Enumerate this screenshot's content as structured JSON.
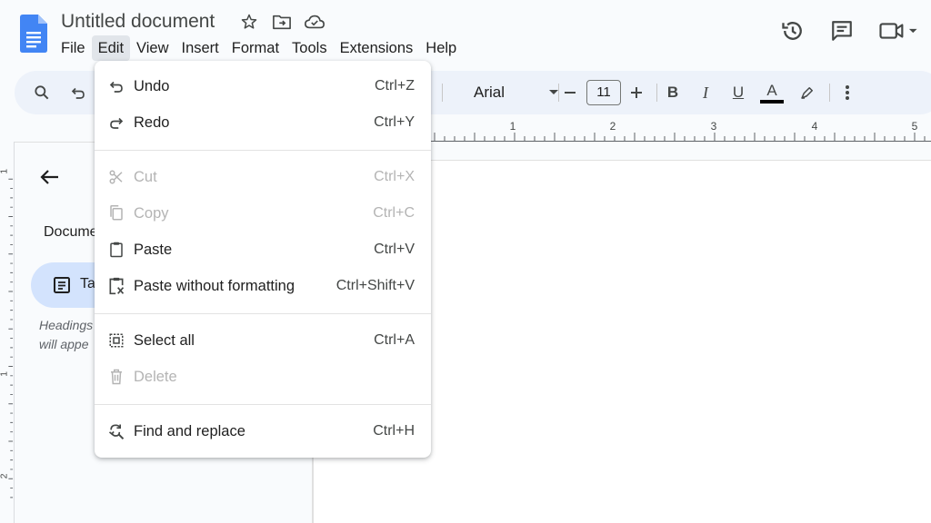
{
  "header": {
    "doc_title": "Untitled document",
    "menu": [
      "File",
      "Edit",
      "View",
      "Insert",
      "Format",
      "Tools",
      "Extensions",
      "Help"
    ],
    "active_menu": "Edit"
  },
  "toolbar": {
    "font_name": "Arial",
    "font_size": "11",
    "bold_label": "B",
    "italic_label": "I",
    "underline_label": "U",
    "text_color_label": "A"
  },
  "ruler": {
    "marks": [
      "1",
      "2",
      "3",
      "4",
      "5"
    ],
    "side_marks": [
      "1",
      "1",
      "2"
    ]
  },
  "sidebar": {
    "heading": "Docume",
    "tab_label": "Ta",
    "note_line1": "Headings",
    "note_line2": "will appe"
  },
  "edit_menu": {
    "groups": [
      [
        {
          "label": "Undo",
          "shortcut": "Ctrl+Z",
          "icon": "undo-icon",
          "disabled": false
        },
        {
          "label": "Redo",
          "shortcut": "Ctrl+Y",
          "icon": "redo-icon",
          "disabled": false
        }
      ],
      [
        {
          "label": "Cut",
          "shortcut": "Ctrl+X",
          "icon": "scissors-icon",
          "disabled": true
        },
        {
          "label": "Copy",
          "shortcut": "Ctrl+C",
          "icon": "copy-icon",
          "disabled": true
        },
        {
          "label": "Paste",
          "shortcut": "Ctrl+V",
          "icon": "clipboard-icon",
          "disabled": false
        },
        {
          "label": "Paste without formatting",
          "shortcut": "Ctrl+Shift+V",
          "icon": "clipboard-clear-icon",
          "disabled": false
        }
      ],
      [
        {
          "label": "Select all",
          "shortcut": "Ctrl+A",
          "icon": "select-all-icon",
          "disabled": false
        },
        {
          "label": "Delete",
          "shortcut": "",
          "icon": "trash-icon",
          "disabled": true
        }
      ],
      [
        {
          "label": "Find and replace",
          "shortcut": "Ctrl+H",
          "icon": "find-replace-icon",
          "disabled": false
        }
      ]
    ]
  },
  "colors": {
    "accent_blue": "#4285f4",
    "tab_pill": "#d3e3fd",
    "toolbar_bg": "#edf2fa",
    "text_color_bar": "#000000"
  }
}
